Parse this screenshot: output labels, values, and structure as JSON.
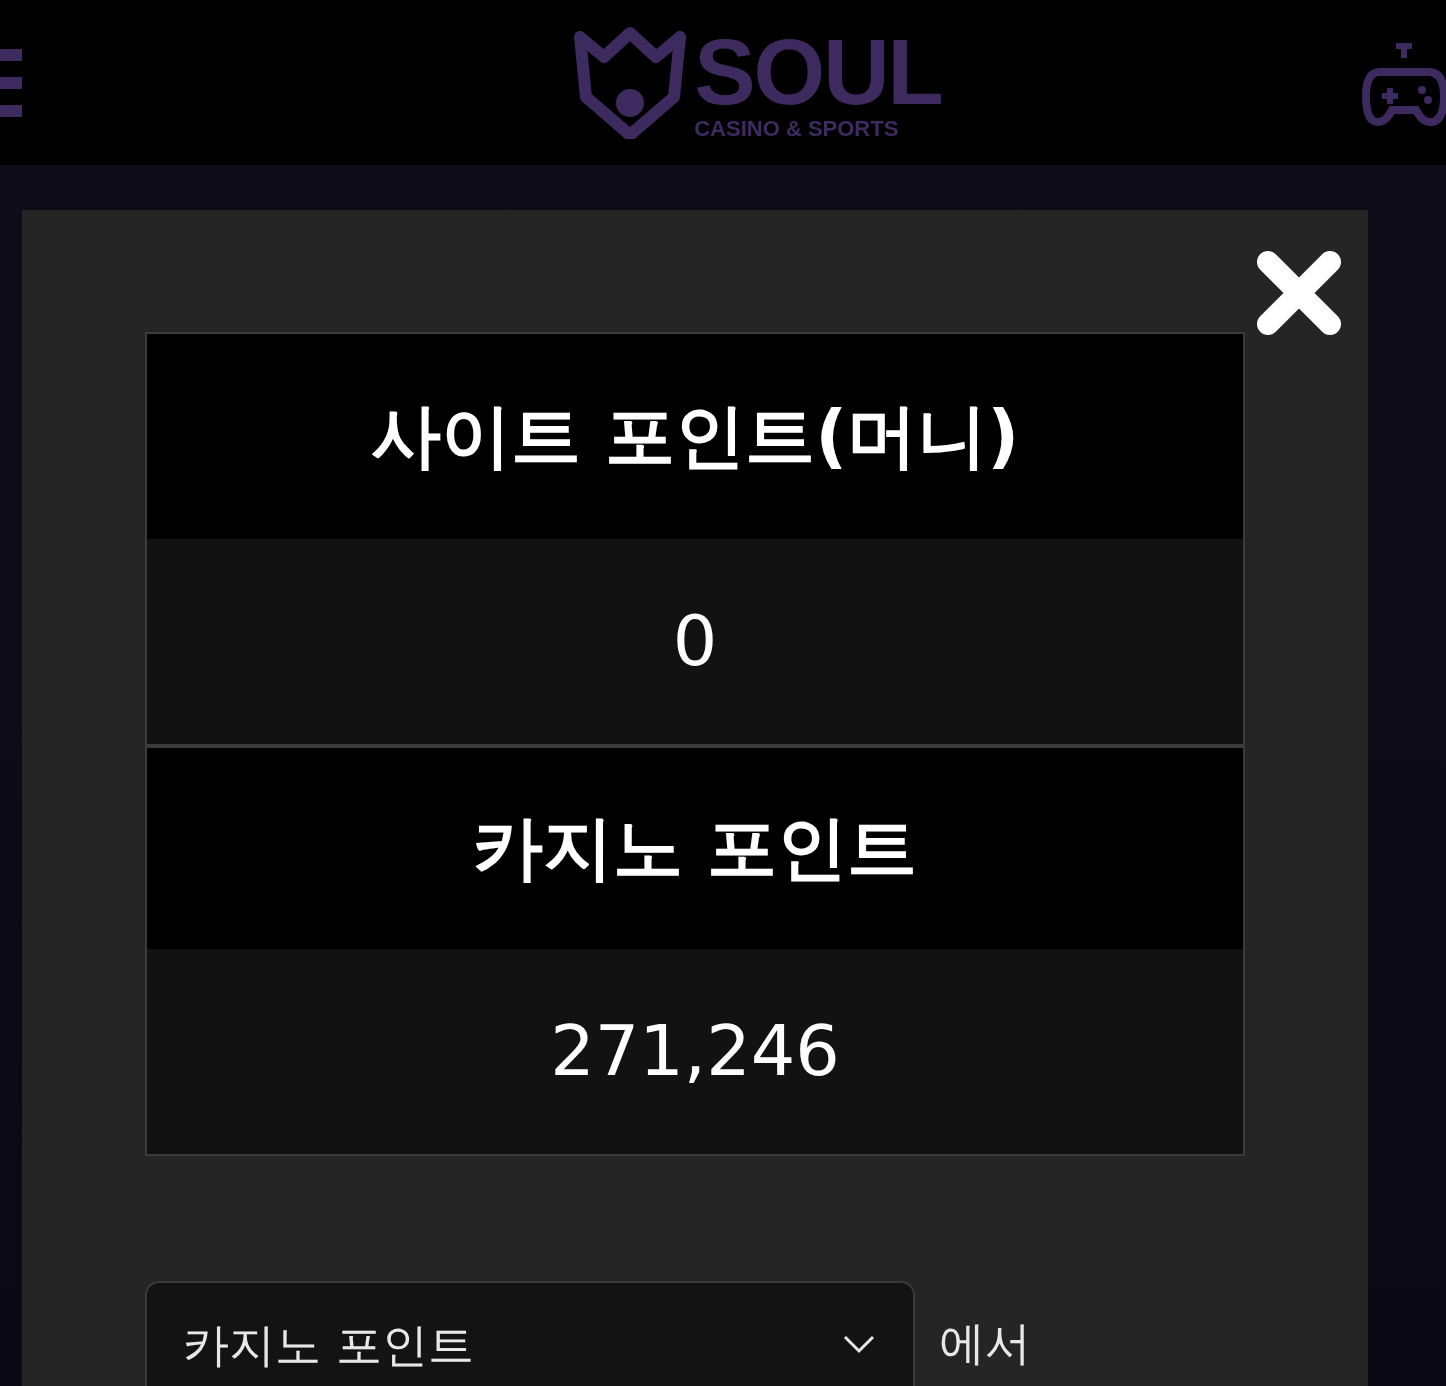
{
  "header": {
    "logo": {
      "title": "SOUL",
      "subtitle": "CASINO & SPORTS"
    }
  },
  "modal": {
    "points": [
      {
        "label": "사이트 포인트(머니)",
        "value": "0"
      },
      {
        "label": "카지노 포인트",
        "value": "271,246"
      }
    ],
    "transfer": {
      "source": "카지노 포인트",
      "suffix": "에서"
    }
  }
}
